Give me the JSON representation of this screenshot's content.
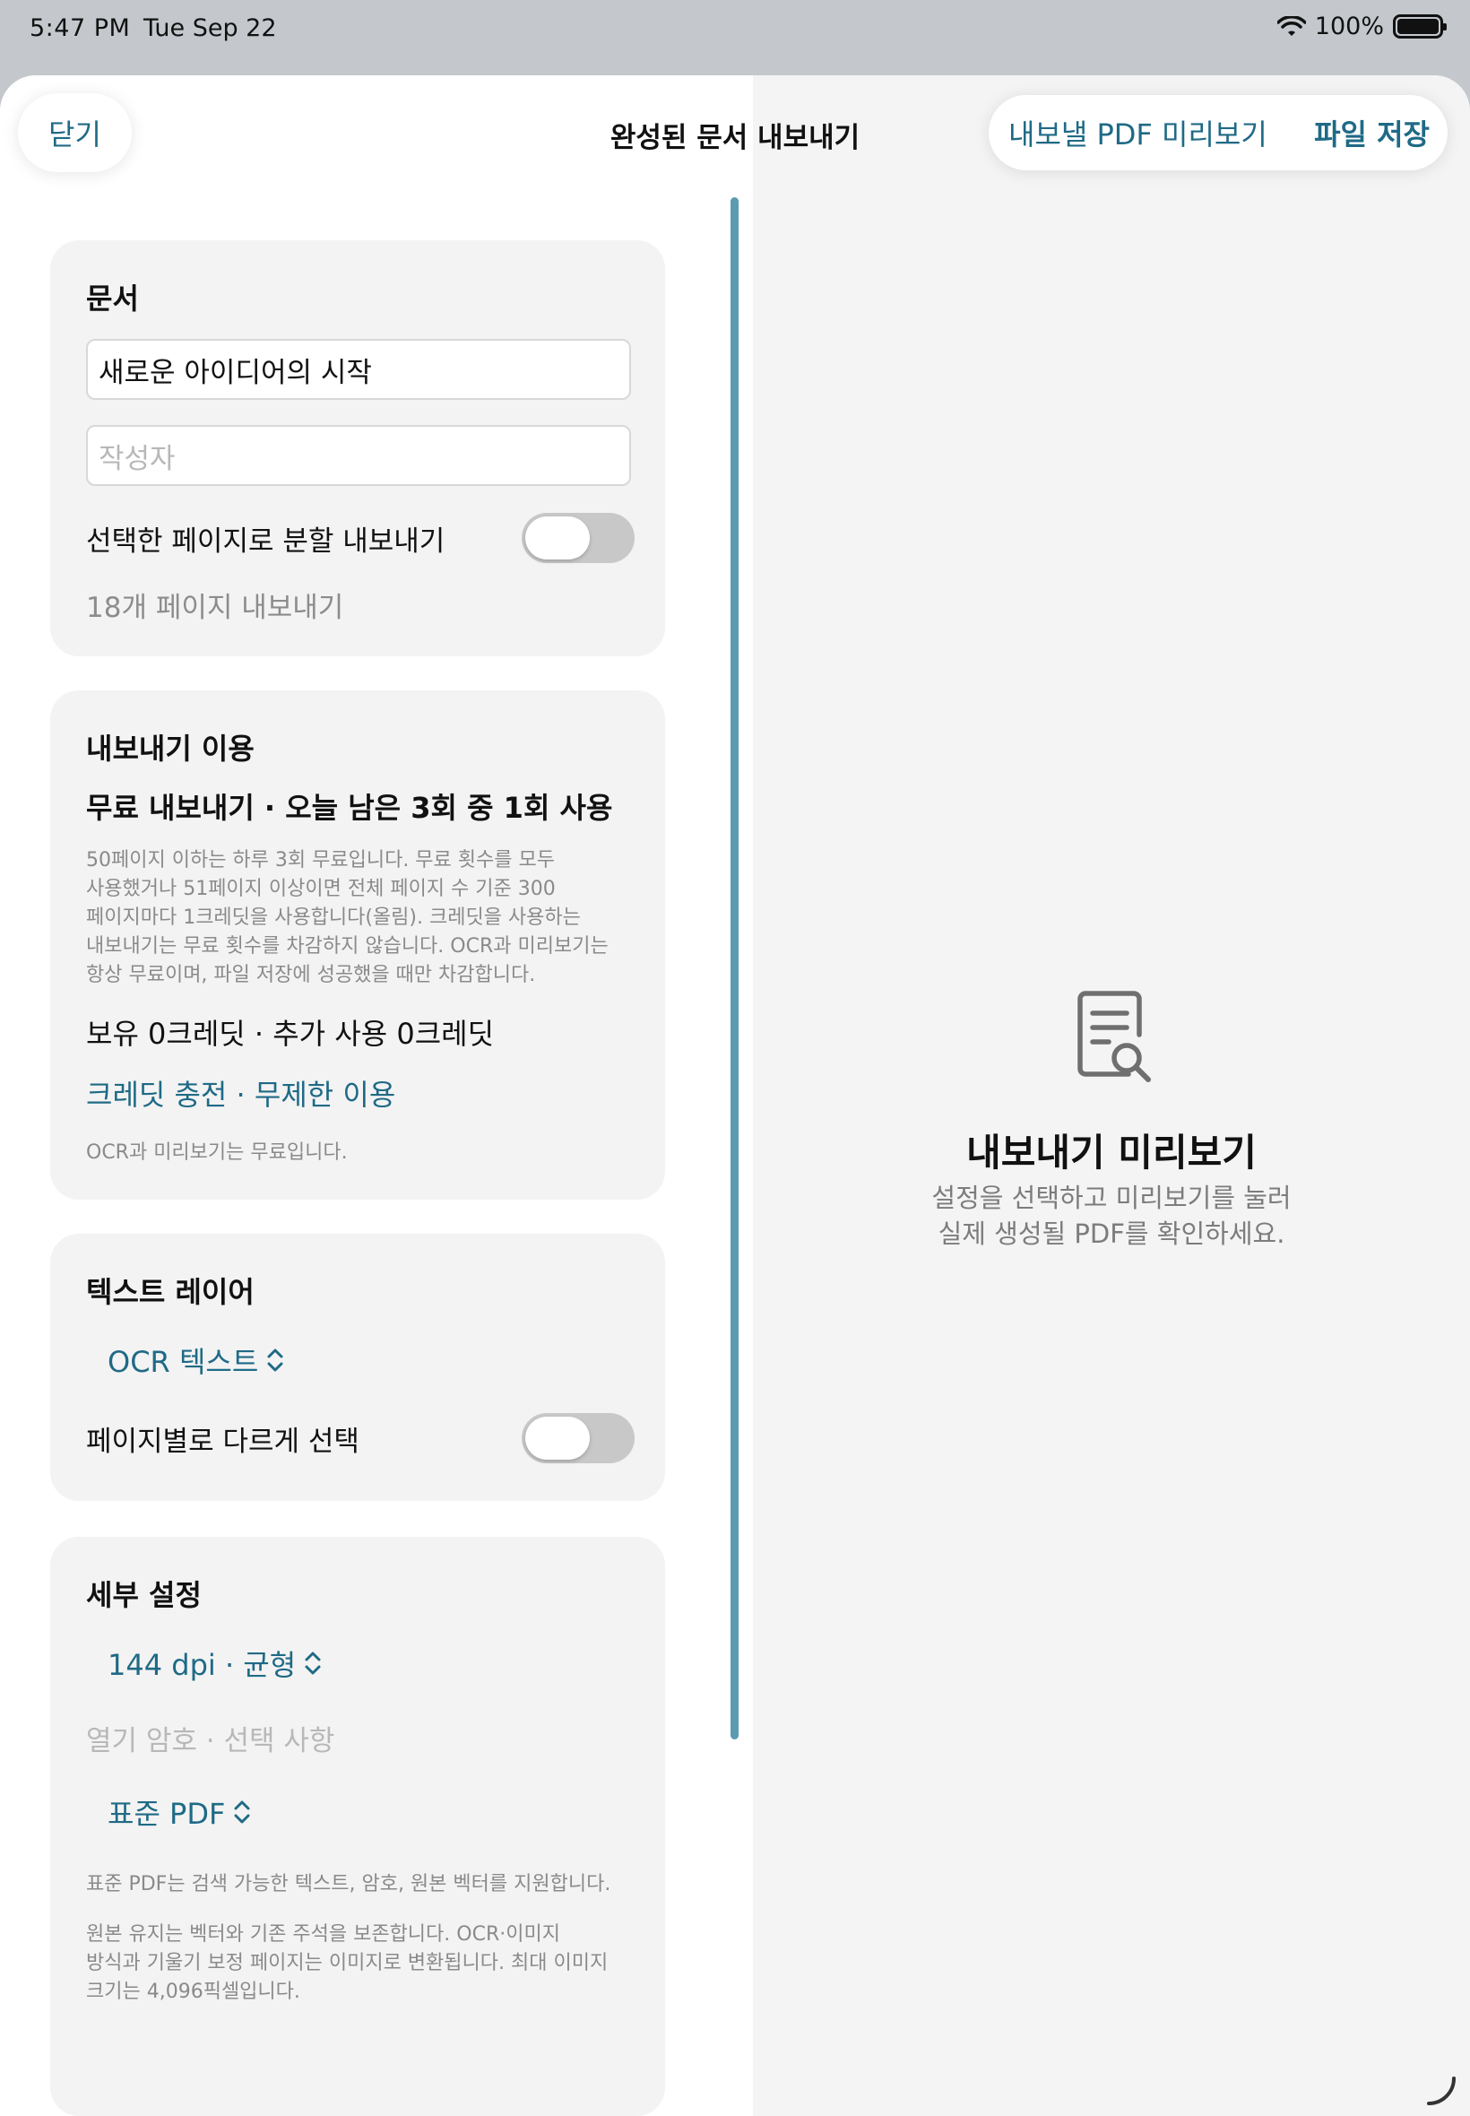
{
  "status_bar": {
    "time": "5:47 PM",
    "date": "Tue Sep 22",
    "battery": "100%"
  },
  "nav": {
    "close_label": "닫기",
    "title": "완성된 문서 내보내기",
    "preview_label": "내보낼 PDF 미리보기",
    "save_label": "파일 저장"
  },
  "document_card": {
    "title": "문서",
    "title_value": "새로운 아이디어의 시작",
    "author_placeholder": "작성자",
    "split_export_label": "선택한 페이지로 분할 내보내기",
    "split_export_on": false,
    "pages_count_label": "18개 페이지 내보내기"
  },
  "usage_card": {
    "title": "내보내기 이용",
    "free_status": "무료 내보내기 · 오늘 남은 3회 중 1회 사용",
    "policy_lines": [
      "50페이지 이하는 하루 3회 무료입니다. 무료 횟수를 모두",
      "사용했거나 51페이지 이상이면 전체 페이지 수 기준 300",
      "페이지마다 1크레딧을 사용합니다(올림). 크레딧을 사용하는",
      "내보내기는 무료 횟수를 차감하지 않습니다. OCR과 미리보기는",
      "항상 무료이며, 파일 저장에 성공했을 때만 차감합니다."
    ],
    "credit_status": "보유 0크레딧 · 추가 사용 0크레딧",
    "credit_link": "크레딧 충전 · 무제한 이용",
    "free_note": "OCR과 미리보기는 무료입니다."
  },
  "text_layer_card": {
    "title": "텍스트 레이어",
    "picker_value": "OCR 텍스트",
    "per_page_label": "페이지별로 다르게 선택",
    "per_page_on": false
  },
  "details_card": {
    "title": "세부 설정",
    "quality_picker": "144 dpi · 균형",
    "password_placeholder": "열기 암호 · 선택 사항",
    "format_picker": "표준 PDF",
    "format_note": "표준 PDF는 검색 가능한 텍스트, 암호, 원본 벡터를 지원합니다.",
    "original_note_lines": [
      "원본 유지는 벡터와 기존 주석을 보존합니다. OCR·이미지",
      "방식과 기울기 보정 페이지는 이미지로 변환됩니다. 최대 이미지",
      "크기는 4,096픽셀입니다."
    ]
  },
  "preview_pane": {
    "icon": "document-search-icon",
    "title": "내보내기 미리보기",
    "desc_lines": [
      "설정을 선택하고 미리보기를 눌러",
      "실제 생성될 PDF를 확인하세요."
    ]
  },
  "colors": {
    "accent": "#1f6a86",
    "card_bg": "#f3f3f3",
    "pane_bg": "#f4f4f4",
    "scrollbar": "#5a9bb3"
  }
}
